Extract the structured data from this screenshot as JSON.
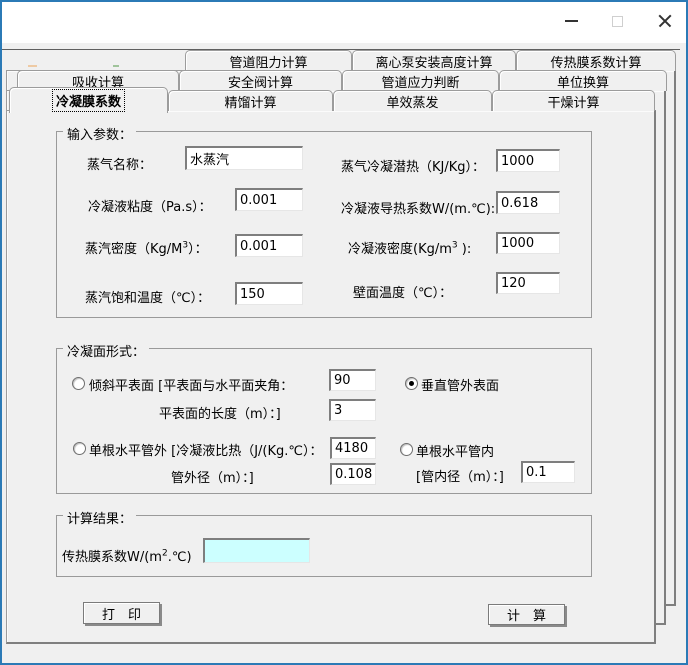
{
  "window": {
    "title": "",
    "controls": {
      "minimize": "minimize",
      "maximize": "maximize",
      "close": "close"
    }
  },
  "colors": {
    "window_border_blue": "#2b7ab6",
    "client_background": "#f0f0f0",
    "result_box_background": "#ccffff",
    "artifact_orange": "#eecaa4",
    "artifact_green": "#9fc39a"
  },
  "tabs": {
    "row1": [
      "管道阻力计算",
      "离心泵安装高度计算",
      "传热膜系数计算"
    ],
    "row2": [
      "吸收计算",
      "安全阀计算",
      "管道应力判断",
      "单位换算"
    ],
    "row3": [
      "冷凝膜系数",
      "精馏计算",
      "单效蒸发",
      "干燥计算"
    ],
    "selected": "冷凝膜系数"
  },
  "input_params": {
    "title": "输入参数：",
    "steam_name": {
      "label": "蒸气名称：",
      "value": "水蒸汽"
    },
    "latent_heat": {
      "label": "蒸气冷凝潜热（KJ/Kg）：",
      "value": "1000"
    },
    "viscosity": {
      "label": "冷凝液粘度（Pa.s）：",
      "value": "0.001"
    },
    "conductivity": {
      "label": "冷凝液导热系数W/(m.℃):",
      "value": "0.618"
    },
    "vapor_density": {
      "label_pre": "蒸汽密度（Kg/M",
      "label_sup": "3",
      "label_post": "）：",
      "value": "0.001"
    },
    "liquid_density": {
      "label_pre": "冷凝液密度(Kg/m",
      "label_sup": "3",
      "label_post": " ):",
      "value": "1000"
    },
    "sat_temp": {
      "label": "蒸汽饱和温度（℃）：",
      "value": "150"
    },
    "wall_temp": {
      "label": "壁面温度（℃）：",
      "value": "120"
    }
  },
  "surface_type": {
    "title": "冷凝面形式：",
    "inclined_plane": {
      "label": "倾斜平表面 [平表面与水平面夹角：",
      "selected": false,
      "angle_value": "90"
    },
    "plane_length": {
      "label": "平表面的长度（m）：]",
      "value": "3"
    },
    "vertical_tube_outside": {
      "label": "垂直管外表面",
      "selected": true
    },
    "horizontal_tube_outside": {
      "label": "单根水平管外 [冷凝液比热（J/(Kg.℃）：",
      "selected": false,
      "specific_heat_value": "4180"
    },
    "outer_diameter": {
      "label": "管外径（m）：]",
      "value": "0.108"
    },
    "horizontal_tube_inside": {
      "label": "单根水平管内",
      "selected": false
    },
    "inner_diameter": {
      "label": "[管内径（m）：]",
      "value": "0.1"
    }
  },
  "result": {
    "title": "计算结果：",
    "coeff_label_pre": "传热膜系数W/(m",
    "coeff_label_sup": "2",
    "coeff_label_post": ".℃)",
    "value": ""
  },
  "buttons": {
    "print": "打　印",
    "calculate": "计　算"
  }
}
